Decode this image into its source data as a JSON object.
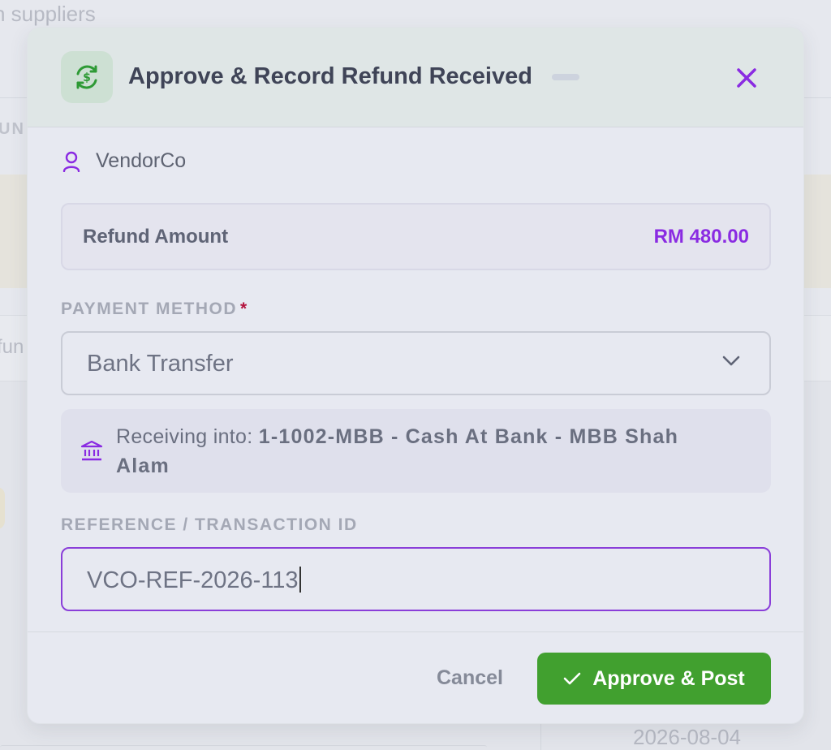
{
  "background": {
    "subtitle": "n suppliers",
    "column_header": "UN",
    "row_text": "fun",
    "date": "2026-08-04"
  },
  "modal": {
    "title": "Approve & Record Refund Received",
    "icon": "refund-dollar-icon",
    "vendor": "VendorCo",
    "refund_amount_label": "Refund Amount",
    "refund_amount_value": "RM 480.00",
    "payment_method": {
      "label": "PAYMENT METHOD",
      "required_mark": "*",
      "selected": "Bank Transfer"
    },
    "receiving_info": {
      "prefix": "Receiving into:",
      "account": "1-1002-MBB - Cash At Bank - MBB Shah Alam"
    },
    "reference": {
      "label": "REFERENCE / TRANSACTION ID",
      "value": "VCO-REF-2026-113"
    },
    "footer": {
      "cancel_label": "Cancel",
      "approve_label": "Approve & Post"
    }
  },
  "colors": {
    "accent_purple": "#8a2be2",
    "approve_green": "#41a02f",
    "header_icon_green": "#2e9a35"
  }
}
